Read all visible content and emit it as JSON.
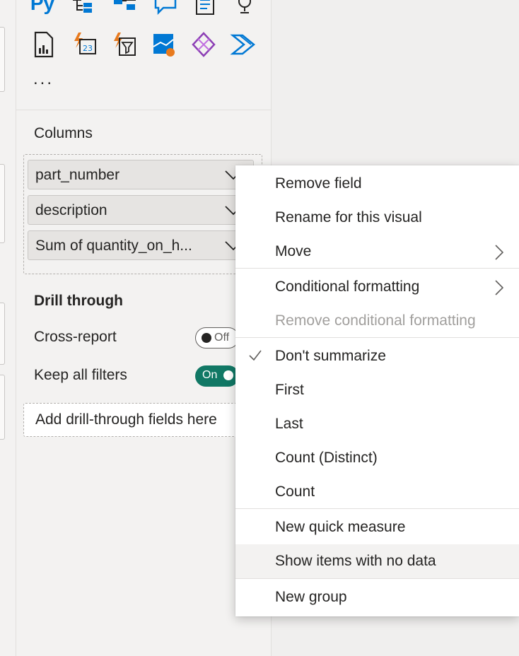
{
  "visualizations": {
    "icons_row1": [
      "python-visual-icon",
      "decomposition-tree-icon",
      "key-influencers-icon",
      "qa-visual-icon",
      "smart-narrative-icon",
      "goals-trophy-icon"
    ],
    "icons_row2": [
      "paginated-report-icon",
      "power-apps-card-icon",
      "power-apps-filter-icon",
      "azure-map-icon",
      "power-apps-icon",
      "power-automate-icon"
    ],
    "python_label": "Py",
    "more_label": "..."
  },
  "columns": {
    "label": "Columns",
    "fields": [
      {
        "label": "part_number"
      },
      {
        "label": "description"
      },
      {
        "label": "Sum of quantity_on_h..."
      }
    ]
  },
  "drill_through": {
    "title": "Drill through",
    "cross_report": {
      "label": "Cross-report",
      "toggle_text": "Off",
      "state": "off"
    },
    "keep_all_filters": {
      "label": "Keep all filters",
      "toggle_text": "On",
      "state": "on"
    },
    "drop_placeholder": "Add drill-through fields here"
  },
  "context_menu": {
    "items": [
      {
        "label": "Remove field"
      },
      {
        "label": "Rename for this visual"
      },
      {
        "label": "Move"
      },
      {
        "label": "Conditional formatting"
      },
      {
        "label": "Remove conditional formatting"
      },
      {
        "label": "Don't summarize"
      },
      {
        "label": "First"
      },
      {
        "label": "Last"
      },
      {
        "label": "Count (Distinct)"
      },
      {
        "label": "Count"
      },
      {
        "label": "New quick measure"
      },
      {
        "label": "Show items with no data"
      },
      {
        "label": "New group"
      }
    ],
    "checked_item": "Don't summarize",
    "disabled_item": "Remove conditional formatting",
    "hovered_item": "Show items with no data"
  },
  "colors": {
    "accent_blue": "#0078d4",
    "toggle_on": "#117865",
    "orange": "#e87a1e",
    "purple": "#8c3fb5"
  }
}
